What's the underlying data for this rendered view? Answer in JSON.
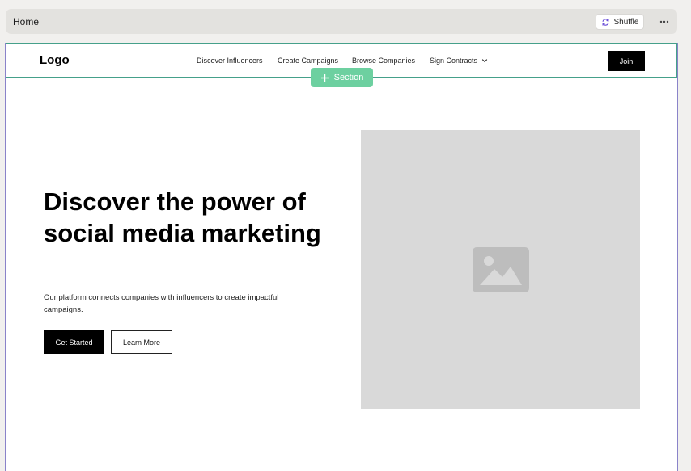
{
  "topbar": {
    "page_name": "Home",
    "shuffle_label": "Shuffle"
  },
  "navbar": {
    "logo": "Logo",
    "links": [
      "Discover Influencers",
      "Create Campaigns",
      "Browse Companies",
      "Sign Contracts"
    ],
    "join_label": "Join"
  },
  "section_pill": {
    "label": "Section"
  },
  "hero": {
    "title": "Discover the power of social media marketing",
    "subtitle": "Our platform connects companies with influencers to create impactful campaigns.",
    "primary_label": "Get Started",
    "secondary_label": "Learn More",
    "image": "image-placeholder-icon"
  },
  "colors": {
    "accent_green": "#6dd0a0",
    "navbar_border": "#45a08a",
    "canvas_border": "#8a83c9",
    "shuffle_icon": "#6b4fd8"
  }
}
